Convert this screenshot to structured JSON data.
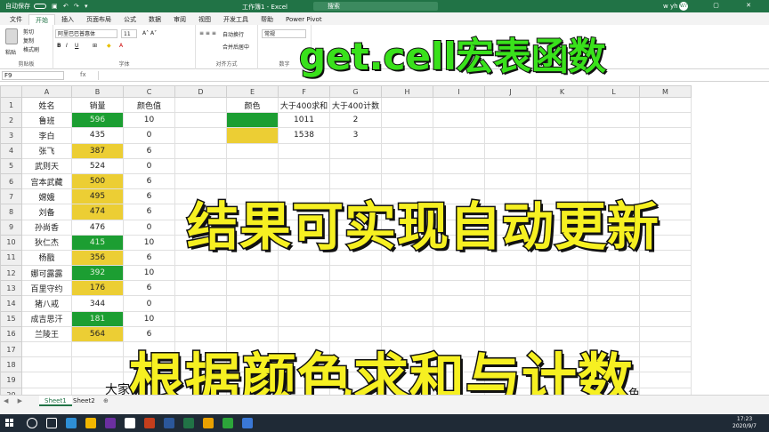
{
  "titlebar": {
    "autosave": "自动保存",
    "title": "工作簿1 - Excel",
    "search": "搜索",
    "user": "w yh",
    "avatar": "WY"
  },
  "tabs": [
    "文件",
    "开始",
    "插入",
    "页面布局",
    "公式",
    "数据",
    "审阅",
    "视图",
    "开发工具",
    "帮助",
    "Power Pivot"
  ],
  "active_tab": "开始",
  "ribbon": {
    "clipboard": {
      "paste": "粘贴",
      "cut": "剪切",
      "copy": "复制",
      "format_painter": "格式刷",
      "label": "剪贴板"
    },
    "font": {
      "name": "阿里巴巴普惠体",
      "size": "11",
      "label": "字体"
    },
    "alignment": {
      "wrap": "自动换行",
      "merge": "合并后居中",
      "label": "对齐方式"
    },
    "number": {
      "format": "常规",
      "label": "数字"
    }
  },
  "formula_bar": {
    "name_box": "F9",
    "fx": "fx",
    "content": ""
  },
  "columns": [
    "A",
    "B",
    "C",
    "D",
    "E",
    "F",
    "G",
    "H",
    "I",
    "J",
    "K",
    "L",
    "M"
  ],
  "rows": [
    {
      "n": "1",
      "A": "姓名",
      "B": "销量",
      "C": "颜色值",
      "E": "颜色",
      "F": "大于400求和",
      "G": "大于400计数"
    },
    {
      "n": "2",
      "A": "鲁班",
      "B": "596",
      "C": "10",
      "E": "",
      "F": "1011",
      "G": "2"
    },
    {
      "n": "3",
      "A": "李白",
      "B": "435",
      "C": "0",
      "E": "",
      "F": "1538",
      "G": "3"
    },
    {
      "n": "4",
      "A": "张飞",
      "B": "387",
      "C": "6"
    },
    {
      "n": "5",
      "A": "武则天",
      "B": "524",
      "C": "0"
    },
    {
      "n": "6",
      "A": "宫本武藏",
      "B": "500",
      "C": "6"
    },
    {
      "n": "7",
      "A": "嫦娥",
      "B": "495",
      "C": "6"
    },
    {
      "n": "8",
      "A": "刘备",
      "B": "474",
      "C": "6"
    },
    {
      "n": "9",
      "A": "孙尚香",
      "B": "476",
      "C": "0"
    },
    {
      "n": "10",
      "A": "狄仁杰",
      "B": "415",
      "C": "10"
    },
    {
      "n": "11",
      "A": "杨戬",
      "B": "356",
      "C": "6"
    },
    {
      "n": "12",
      "A": "娜可露露",
      "B": "392",
      "C": "10"
    },
    {
      "n": "13",
      "A": "百里守约",
      "B": "176",
      "C": "6"
    },
    {
      "n": "14",
      "A": "猪八戒",
      "B": "344",
      "C": "0"
    },
    {
      "n": "15",
      "A": "成吉思汗",
      "B": "181",
      "C": "10"
    },
    {
      "n": "16",
      "A": "兰陵王",
      "B": "564",
      "C": "6"
    },
    {
      "n": "17"
    },
    {
      "n": "18"
    },
    {
      "n": "19"
    },
    {
      "n": "20"
    }
  ],
  "cell_colors": {
    "green": "#1c9e32",
    "yellow": "#ecce34"
  },
  "overlays": {
    "title": "get.cell宏表函数",
    "middle": "结果可实现自动更新",
    "bottom": "根据颜色求和与计数",
    "subtitle_left": "大家",
    "subtitle_right": "色"
  },
  "sheet_tabs": [
    "Sheet1",
    "Sheet2"
  ],
  "active_sheet": "Sheet1",
  "clock": {
    "time": "17:23",
    "date": "2020/9/7"
  }
}
